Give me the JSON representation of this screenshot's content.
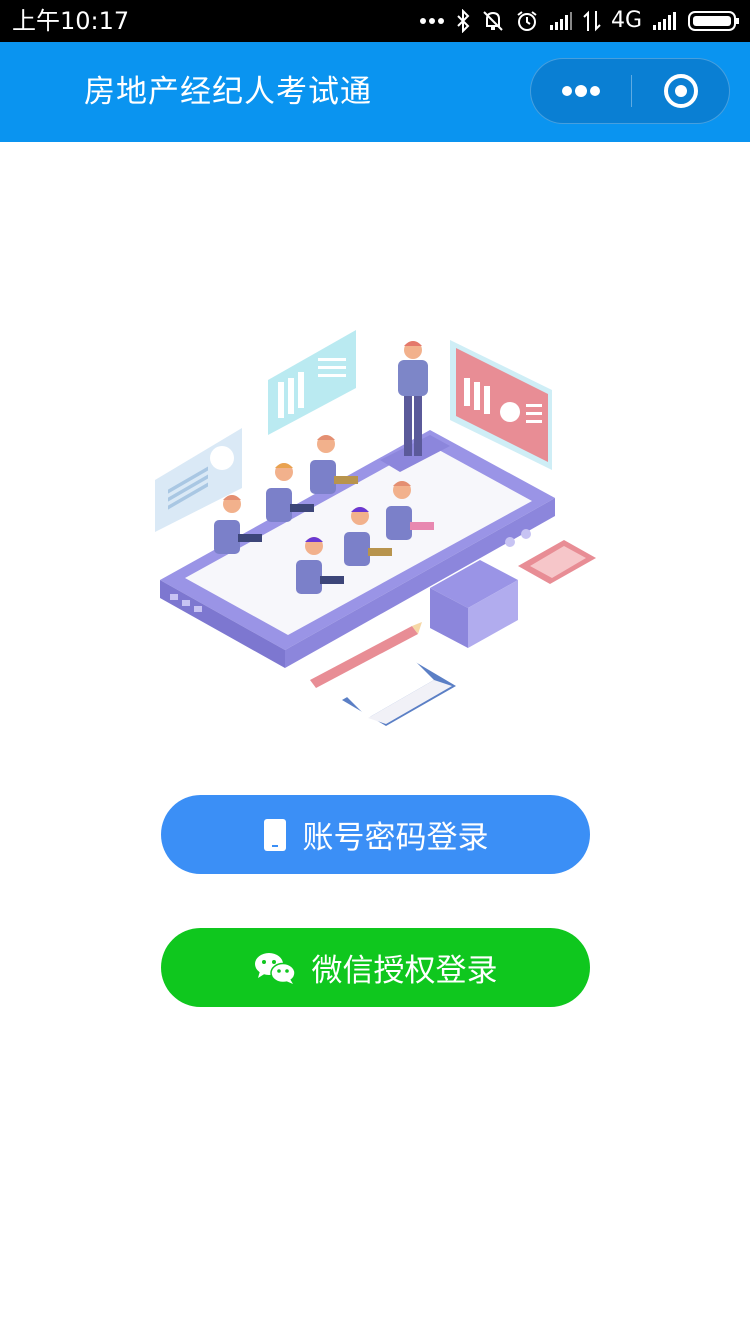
{
  "status_bar": {
    "time": "上午10:17",
    "network": "4G",
    "icons": [
      "more-dots-icon",
      "bluetooth-icon",
      "mute-icon",
      "alarm-icon",
      "signal-icon",
      "data-transfer-icon",
      "signal-icon",
      "battery-icon"
    ]
  },
  "nav": {
    "title": "房地产经纪人考试通",
    "menu_icon": "more-dots-icon",
    "close_icon": "target-close-icon"
  },
  "illustration": {
    "icon": "classroom-illustration"
  },
  "buttons": {
    "account_login": "账号密码登录",
    "account_icon": "phone-icon",
    "wechat_login": "微信授权登录",
    "wechat_icon": "wechat-icon"
  },
  "colors": {
    "nav_bg": "#0a94f0",
    "account_button": "#3b8ff6",
    "wechat_button": "#0fc71e"
  }
}
